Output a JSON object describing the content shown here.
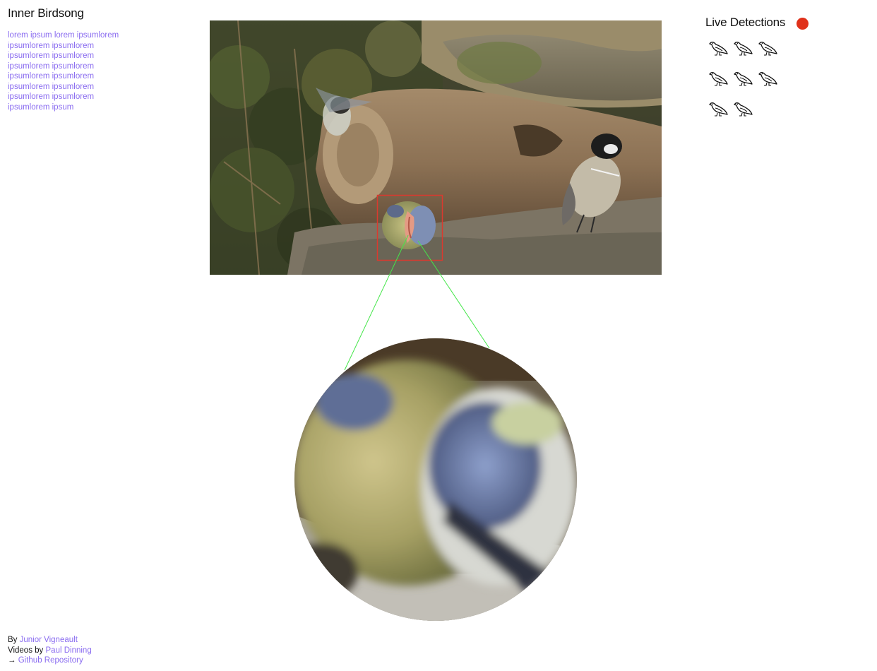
{
  "app": {
    "title": "Inner Birdsong",
    "description": "lorem ipsum lorem ipsumlorem ipsumlorem ipsumlorem ipsumlorem ipsumlorem ipsumlorem ipsumlorem ipsumlorem ipsumlorem ipsumlorem ipsumlorem ipsumlorem ipsumlorem ipsumlorem ipsum"
  },
  "credits": {
    "by_prefix": "By ",
    "author": "Junior Vigneault",
    "videos_prefix": "Videos by ",
    "videographer": "Paul Dinning",
    "arrow": "→ ",
    "repo_label": "Github Repository"
  },
  "video": {
    "detection_box_color": "#d93a2f",
    "connector_color": "#45e64a"
  },
  "detections": {
    "title": "Live Detections",
    "status_color": "#e0311a",
    "icon": "bird-icon",
    "count": 8,
    "rows": [
      3,
      3,
      2
    ]
  },
  "colors": {
    "accent": "#8a6cf0",
    "text": "#111111"
  }
}
